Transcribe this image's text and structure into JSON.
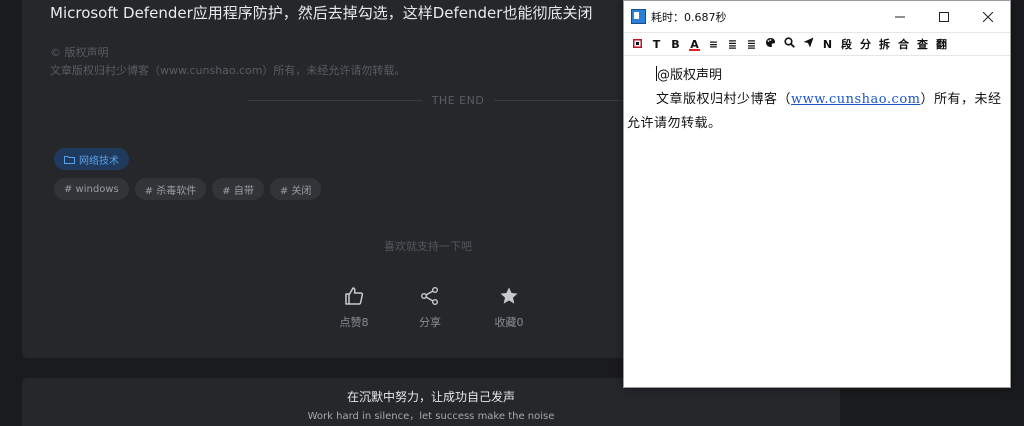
{
  "article": {
    "title": "Microsoft Defender应用程序防护，然后去掉勾选，这样Defender也能彻底关闭",
    "copyright_head": "© 版权声明",
    "copyright_text": "文章版权归村少博客（www.cunshao.com）所有，未经允许请勿转载。",
    "the_end": "THE END",
    "category": "网络技术",
    "tags": [
      "# windows",
      "# 杀毒软件",
      "# 自带",
      "# 关闭"
    ],
    "support_text": "喜欢就支持一下吧",
    "actions": {
      "like": "点赞8",
      "share": "分享",
      "favorite": "收藏0"
    }
  },
  "footer": {
    "slogan": "在沉默中努力，让成功自己发声",
    "slogan_en": "Work hard in silence，let success make the noise"
  },
  "window": {
    "title": "耗时：0.687秒",
    "toolbar": [
      "T",
      "B",
      "A",
      "≡",
      "≣",
      "≣",
      "N",
      "段",
      "分",
      "拆",
      "合",
      "查",
      "翻"
    ],
    "line1": "@版权声明",
    "p2_before": "文章版权归村少博客（",
    "p2_link": "www.cunshao.com",
    "p2_after": "）所有，未经允许请勿转载。"
  },
  "colors": {
    "background": "#1a1b1e",
    "card": "#26272b",
    "accent_blue": "#5aa0e8",
    "link": "#1a56c8"
  }
}
